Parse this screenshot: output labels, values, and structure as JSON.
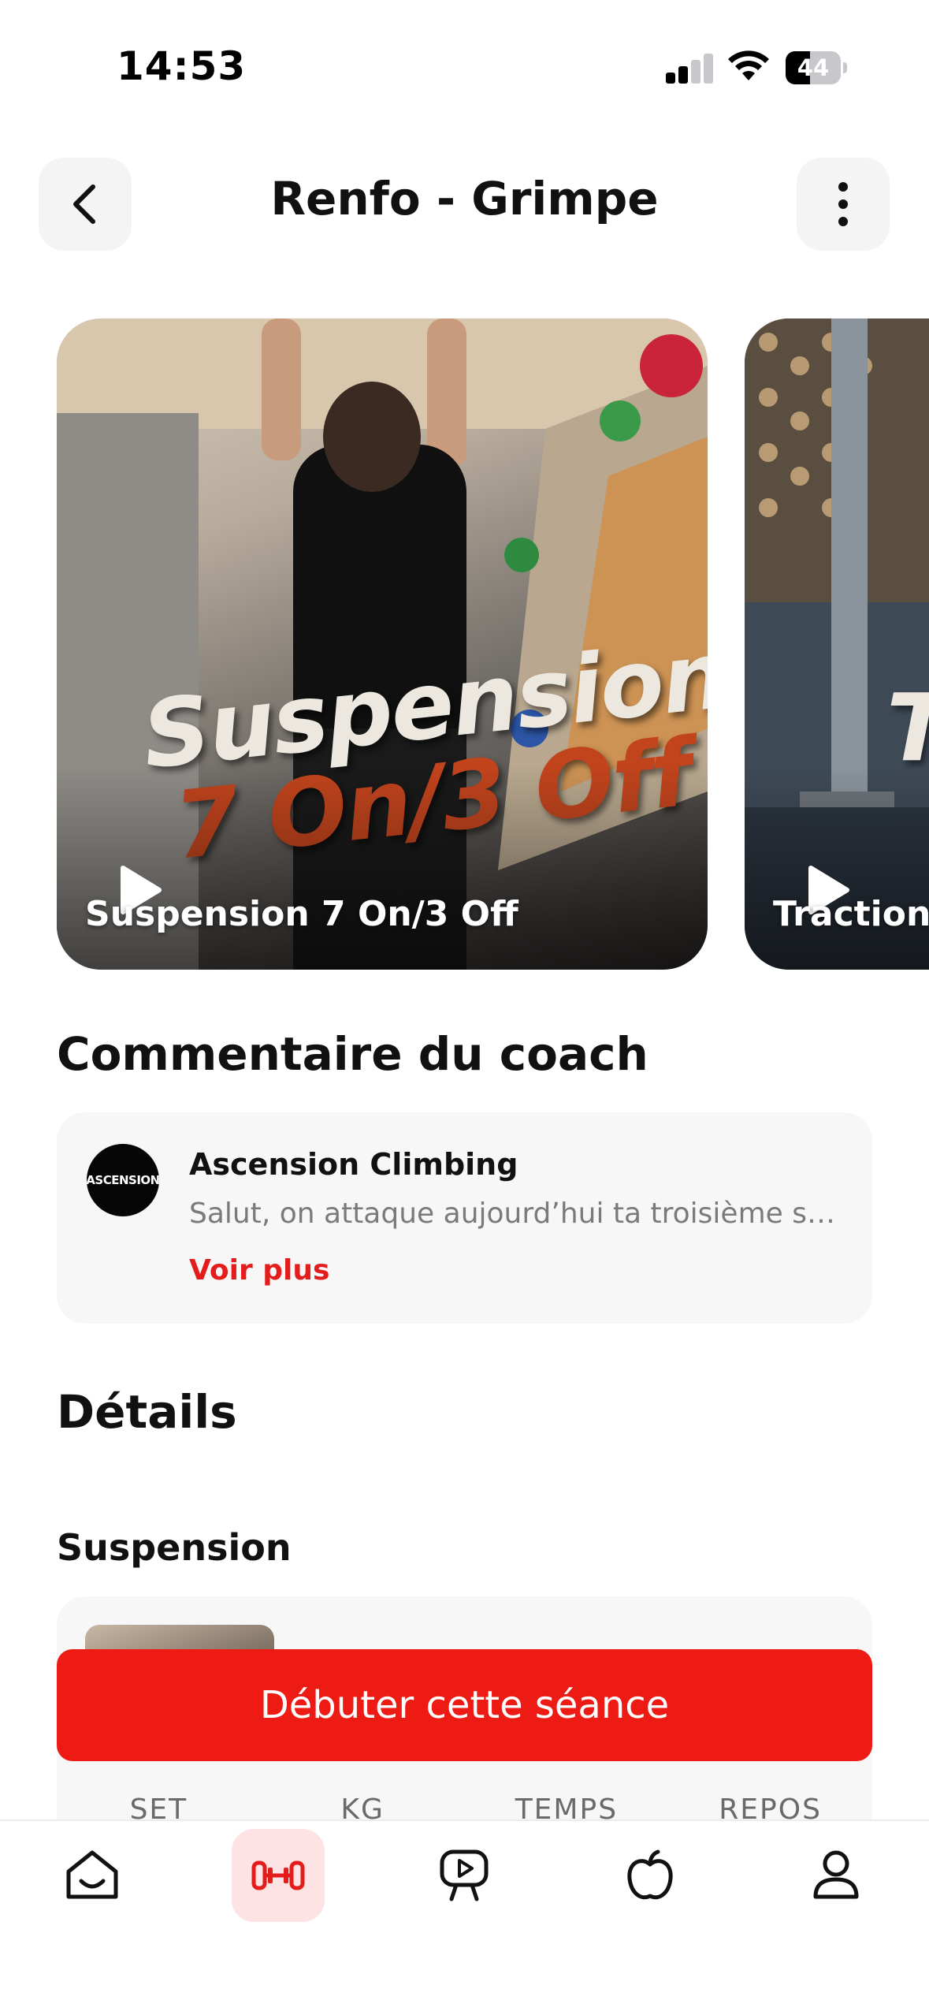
{
  "status_bar": {
    "time": "14:53",
    "battery_level": "44",
    "signal_bars_active": 2,
    "signal_bars_total": 4,
    "icons": [
      "cellular-signal-icon",
      "wifi-icon",
      "battery-icon"
    ]
  },
  "header": {
    "title": "Renfo - Grimpe",
    "back_icon": "chevron-left-icon",
    "more_icon": "more-vertical-icon"
  },
  "carousel": {
    "cards": [
      {
        "caption": "Suspension 7 On/3 Off",
        "overlay_line1": "Suspension",
        "overlay_line2": "7 On/3 Off",
        "icon": "play-icon"
      },
      {
        "caption": "Traction",
        "overlay_line1": "T",
        "icon": "play-icon"
      }
    ]
  },
  "coach": {
    "section_title": "Commentaire du coach",
    "avatar_text": "ASCENSION",
    "name": "Ascension Climbing",
    "message": "Salut, on attaque aujourd’hui ta troisième sé…",
    "more_label": "Voir plus"
  },
  "details": {
    "section_title": "Détails",
    "exercise_title": "Suspension",
    "columns": [
      "SET",
      "KG",
      "TEMPS",
      "REPOS"
    ]
  },
  "cta": {
    "label": "Débuter cette séance"
  },
  "tab_bar": {
    "active": "workout",
    "tabs": [
      {
        "id": "home",
        "icon": "home-icon"
      },
      {
        "id": "workout",
        "icon": "dumbbell-icon"
      },
      {
        "id": "video",
        "icon": "video-play-icon"
      },
      {
        "id": "nutrition",
        "icon": "apple-icon"
      },
      {
        "id": "profile",
        "icon": "user-icon"
      }
    ]
  },
  "colors": {
    "accent": "#ee1a14",
    "accent_text": "#e41c1c",
    "active_tab_bg": "#fde3e3",
    "card_bg": "#f7f7f7"
  }
}
